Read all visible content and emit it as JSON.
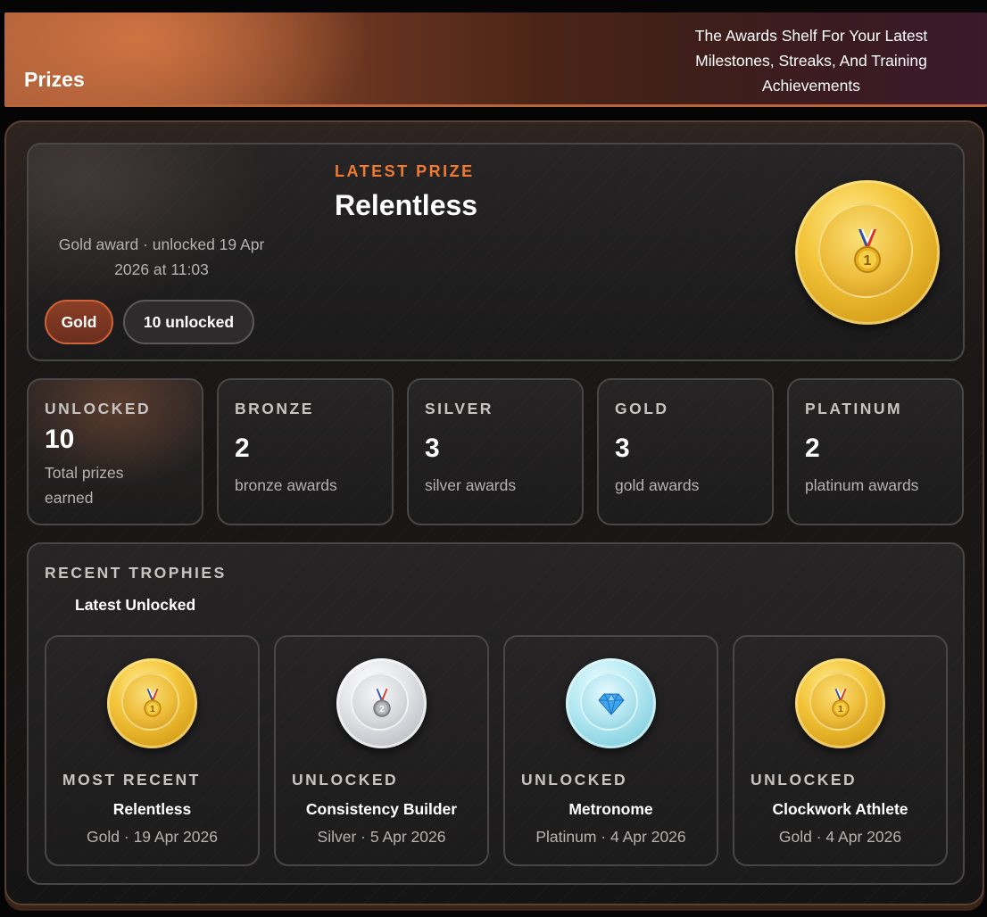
{
  "header": {
    "title": "Prizes",
    "subtitle": "The Awards Shelf For Your Latest Milestones, Streaks, And Training Achievements"
  },
  "latest_prize": {
    "eyebrow": "LATEST PRIZE",
    "name": "Relentless",
    "meta": "Gold award · unlocked 19 Apr 2026 at 11:03",
    "tier_pill": "Gold",
    "count_pill": "10 unlocked",
    "medal_icon": "gold-medal-icon",
    "medal_number": "1"
  },
  "stats": [
    {
      "label": "UNLOCKED",
      "value": "10",
      "desc": "Total prizes earned"
    },
    {
      "label": "BRONZE",
      "value": "2",
      "desc": "bronze awards"
    },
    {
      "label": "SILVER",
      "value": "3",
      "desc": "silver awards"
    },
    {
      "label": "GOLD",
      "value": "3",
      "desc": "gold awards"
    },
    {
      "label": "PLATINUM",
      "value": "2",
      "desc": "platinum awards"
    }
  ],
  "recent": {
    "title": "RECENT TROPHIES",
    "subtitle": "Latest Unlocked",
    "items": [
      {
        "label": "MOST RECENT",
        "name": "Relentless",
        "meta": "Gold · 19 Apr 2026",
        "tier": "gold",
        "number": "1"
      },
      {
        "label": "UNLOCKED",
        "name": "Consistency Builder",
        "meta": "Silver · 5 Apr 2026",
        "tier": "silver",
        "number": "2"
      },
      {
        "label": "UNLOCKED",
        "name": "Metronome",
        "meta": "Platinum · 4 Apr 2026",
        "tier": "platinum",
        "number": ""
      },
      {
        "label": "UNLOCKED",
        "name": "Clockwork Athlete",
        "meta": "Gold · 4 Apr 2026",
        "tier": "gold",
        "number": "1"
      }
    ]
  },
  "colors": {
    "accent": "#f07a32",
    "gold": "#f3c53a",
    "silver": "#d7d8dc",
    "platinum": "#aee3ee"
  }
}
